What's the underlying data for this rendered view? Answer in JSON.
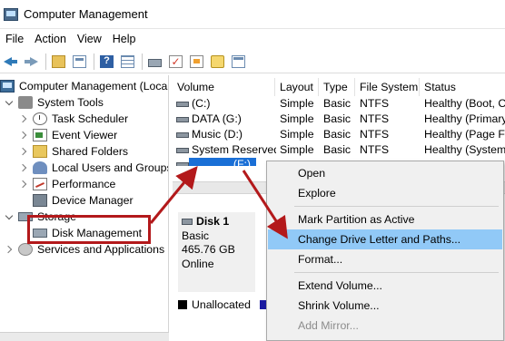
{
  "window": {
    "title": "Computer Management",
    "icon": "computer-management-icon"
  },
  "menu": [
    "File",
    "Action",
    "View",
    "Help"
  ],
  "toolbar": {
    "icons": [
      "back-arrow-icon",
      "forward-arrow-icon",
      "up-folder-icon",
      "show-hide-tree-icon",
      "help-icon",
      "properties-icon",
      "connect-drive-icon",
      "check-icon",
      "export-icon",
      "search-icon",
      "new-window-icon"
    ]
  },
  "tree": {
    "root": "Computer Management (Local",
    "system_tools": "System Tools",
    "task_scheduler": "Task Scheduler",
    "event_viewer": "Event Viewer",
    "shared_folders": "Shared Folders",
    "local_users": "Local Users and Groups",
    "performance": "Performance",
    "device_manager": "Device Manager",
    "storage": "Storage",
    "disk_management": "Disk Management",
    "services": "Services and Applications"
  },
  "volumes": {
    "columns": [
      "Volume",
      "Layout",
      "Type",
      "File System",
      "Status"
    ],
    "rows": [
      {
        "volume": "(C:)",
        "layout": "Simple",
        "type": "Basic",
        "fs": "NTFS",
        "status": "Healthy (Boot, Cr"
      },
      {
        "volume": "DATA (G:)",
        "layout": "Simple",
        "type": "Basic",
        "fs": "NTFS",
        "status": "Healthy (Primary"
      },
      {
        "volume": "Music (D:)",
        "layout": "Simple",
        "type": "Basic",
        "fs": "NTFS",
        "status": "Healthy (Page Fil"
      },
      {
        "volume": "System Reserved",
        "layout": "Simple",
        "type": "Basic",
        "fs": "NTFS",
        "status": "Healthy (System,"
      },
      {
        "volume": "(F:)",
        "layout": "",
        "type": "",
        "fs": "",
        "status": ""
      }
    ]
  },
  "disk": {
    "name": "Disk 1",
    "type": "Basic",
    "size": "465.76 GB",
    "state": "Online"
  },
  "legend": {
    "unallocated": "Unallocated"
  },
  "context_menu": {
    "open": "Open",
    "explore": "Explore",
    "mark_active": "Mark Partition as Active",
    "change_letter": "Change Drive Letter and Paths...",
    "format": "Format...",
    "extend": "Extend Volume...",
    "shrink": "Shrink Volume...",
    "add_mirror": "Add Mirror..."
  },
  "colors": {
    "selection": "#1a6fd6",
    "menu_highlight": "#91c9f7",
    "annotation": "#b3191b"
  }
}
